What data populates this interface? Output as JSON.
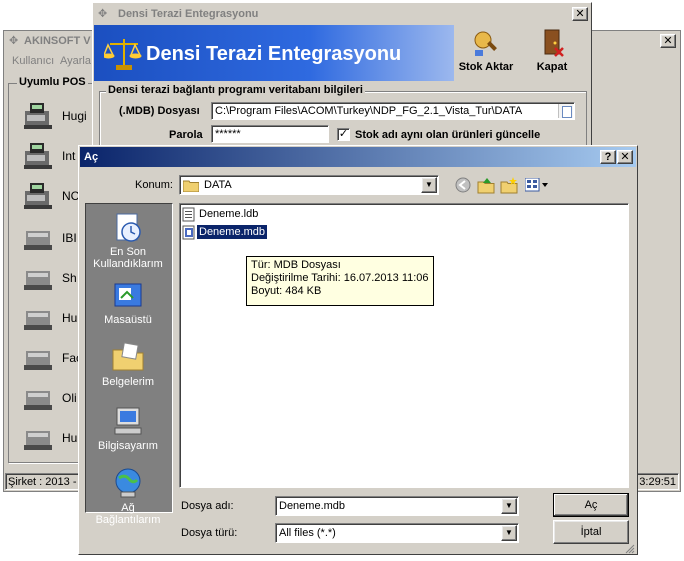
{
  "akinsoft": {
    "title": "AKINSOFT V",
    "menu": [
      "Kullanıcı",
      "Ayarla"
    ],
    "group_label": "Uyumlu POS",
    "pos_items": [
      "Hugi",
      "Int",
      "NC",
      "IBI",
      "Sh",
      "Hu",
      "Fac",
      "Oli",
      "Hu"
    ],
    "status_left": "Şirket : 2013 -",
    "status_right": "3:29:51"
  },
  "densi": {
    "title": "Densi Terazi Entegrasyonu",
    "banner_title": "Densi Terazi Entegrasyonu",
    "stok_aktar": "Stok Aktar",
    "kapat": "Kapat",
    "group_label": "Densi terazi bağlantı programı veritabanı bilgileri",
    "mdb_label": "(.MDB) Dosyası",
    "mdb_path": "C:\\Program Files\\ACOM\\Turkey\\NDP_FG_2.1_Vista_Tur\\DATA",
    "parola_label": "Parola",
    "parola_value": "******",
    "checkbox_label": "Stok adı aynı olan ürünleri güncelle"
  },
  "dialog": {
    "title": "Aç",
    "konum_label": "Konum:",
    "konum_value": "DATA",
    "places": [
      "En Son Kullandıklarım",
      "Masaüstü",
      "Belgelerim",
      "Bilgisayarım",
      "Ağ Bağlantılarım"
    ],
    "files": [
      "Deneme.ldb",
      "Deneme.mdb"
    ],
    "selected_file": "Deneme.mdb",
    "tooltip": [
      "Tür: MDB Dosyası",
      "Değiştirilme Tarihi: 16.07.2013 11:06",
      "Boyut: 484 KB"
    ],
    "dosya_adi_label": "Dosya adı:",
    "dosya_adi_value": "Deneme.mdb",
    "dosya_turu_label": "Dosya türü:",
    "dosya_turu_value": "All files (*.*)",
    "ac_button": "Aç",
    "iptal_button": "İptal"
  },
  "colors": {
    "face": "#d4d0c8",
    "banner": "#2a59c8",
    "places_bg": "#808080",
    "selection": "#0a246a",
    "tooltip": "#ffffe1"
  }
}
